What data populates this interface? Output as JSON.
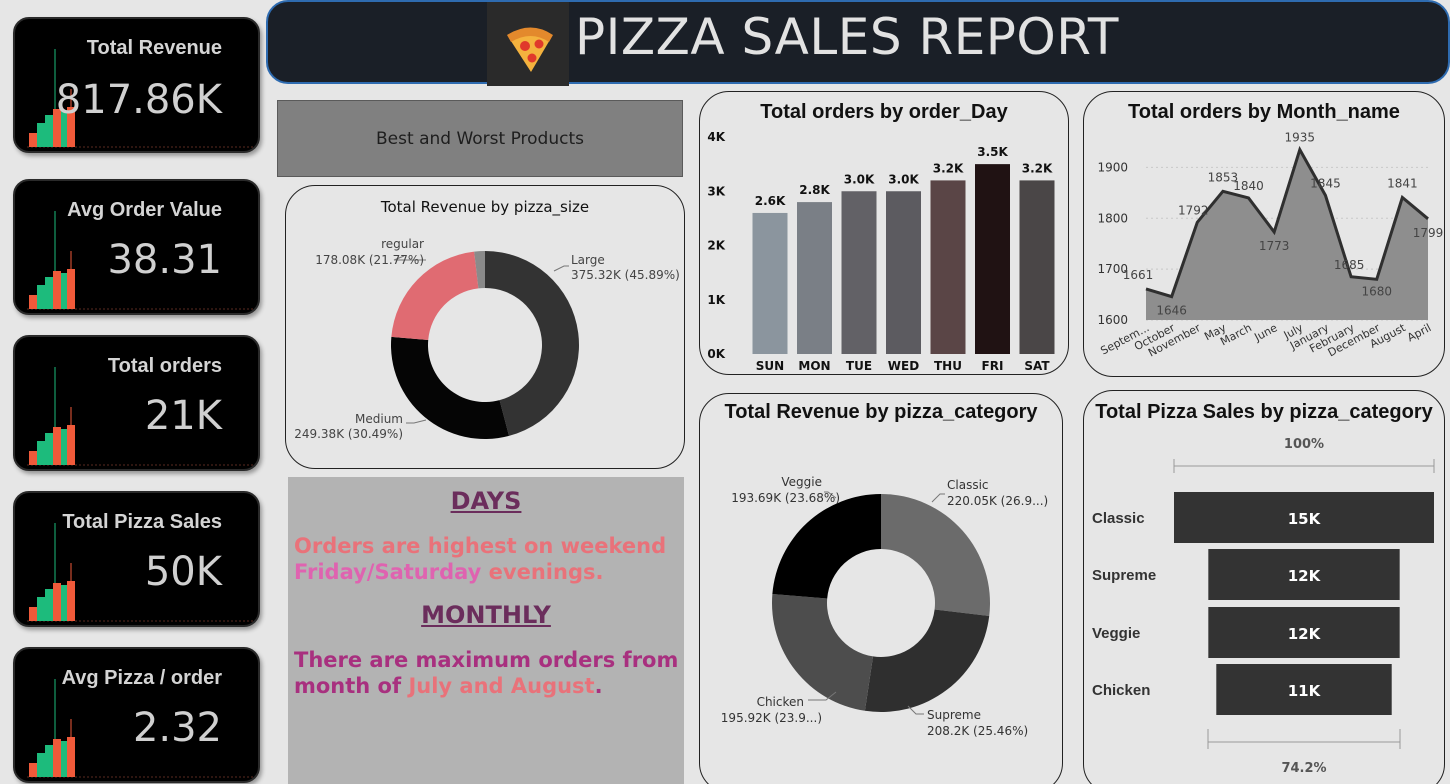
{
  "header": {
    "title": "PIZZA SALES REPORT",
    "logo_icon": "pizza-icon"
  },
  "kpis": [
    {
      "label": "Total Revenue",
      "value": "817.86K"
    },
    {
      "label": "Avg Order Value",
      "value": "38.31"
    },
    {
      "label": "Total orders",
      "value": "21K"
    },
    {
      "label": "Total Pizza Sales",
      "value": "50K"
    },
    {
      "label": "Avg Pizza / order",
      "value": "2.32"
    }
  ],
  "best_worst_button": "Best and Worst Products",
  "insights": {
    "days_heading": "DAYS",
    "days_text_1": "Orders are highest on weekend",
    "days_highlight": "Friday/Saturday",
    "days_text_2": " evenings.",
    "monthly_heading": "MONTHLY",
    "monthly_text_1": "There are maximum orders from month of ",
    "monthly_highlight": "July and August",
    "monthly_text_2": "."
  },
  "colors": {
    "accent_green": "#1dbb7c",
    "accent_red": "#f05a3a",
    "header_border": "#2e6bb0"
  },
  "chart_data": [
    {
      "id": "size",
      "type": "pie",
      "title": "Total Revenue by pizza_size",
      "slices": [
        {
          "name": "Large",
          "value": 375.32,
          "label": "375.32K (45.89%)",
          "color": "#333333"
        },
        {
          "name": "Medium",
          "value": 249.38,
          "label": "249.38K (30.49%)",
          "color": "#050505"
        },
        {
          "name": "regular",
          "value": 178.08,
          "label": "178.08K (21.77%)",
          "color": "#e06b72"
        },
        {
          "name": "",
          "value": 15.08,
          "label": "",
          "color": "#8a8a8a"
        }
      ]
    },
    {
      "id": "day",
      "type": "bar",
      "title": "Total orders by order_Day",
      "categories": [
        "SUN",
        "MON",
        "TUE",
        "WED",
        "THU",
        "FRI",
        "SAT"
      ],
      "values": [
        2.6,
        2.8,
        3.0,
        3.0,
        3.2,
        3.5,
        3.2
      ],
      "labels": [
        "2.6K",
        "2.8K",
        "3.0K",
        "3.0K",
        "3.2K",
        "3.5K",
        "3.2K"
      ],
      "colors": [
        "#8b959e",
        "#7a7f86",
        "#626166",
        "#5c5b60",
        "#5a4546",
        "#201213",
        "#4a4647"
      ],
      "yticks": [
        "0K",
        "1K",
        "2K",
        "3K",
        "4K"
      ],
      "ylim": [
        0,
        4
      ]
    },
    {
      "id": "month",
      "type": "area",
      "title": "Total orders by Month_name",
      "categories": [
        "Septem...",
        "October",
        "November",
        "May",
        "March",
        "June",
        "July",
        "January",
        "February",
        "December",
        "August",
        "April"
      ],
      "values": [
        1661,
        1646,
        1792,
        1853,
        1840,
        1773,
        1935,
        1845,
        1685,
        1680,
        1841,
        1799
      ],
      "yticks": [
        "1600",
        "1700",
        "1800",
        "1900"
      ],
      "ylim": [
        1600,
        1950
      ]
    },
    {
      "id": "category",
      "type": "pie",
      "title": "Total Revenue by pizza_category",
      "slices": [
        {
          "name": "Classic",
          "value": 220.05,
          "label": "220.05K (26.9...)",
          "color": "#6b6b6b"
        },
        {
          "name": "Supreme",
          "value": 208.2,
          "label": "208.2K (25.46%)",
          "color": "#2f2f2f"
        },
        {
          "name": "Chicken",
          "value": 195.92,
          "label": "195.92K (23.9...)",
          "color": "#4d4d4d"
        },
        {
          "name": "Veggie",
          "value": 193.69,
          "label": "193.69K (23.68%)",
          "color": "#000000"
        }
      ]
    },
    {
      "id": "funnel",
      "type": "bar",
      "title": "Total Pizza Sales by pizza_category",
      "categories": [
        "Classic",
        "Supreme",
        "Veggie",
        "Chicken"
      ],
      "values": [
        15,
        12,
        12,
        11
      ],
      "labels": [
        "15K",
        "12K",
        "12K",
        "11K"
      ],
      "top_label": "100%",
      "bottom_label": "74.2%"
    }
  ]
}
